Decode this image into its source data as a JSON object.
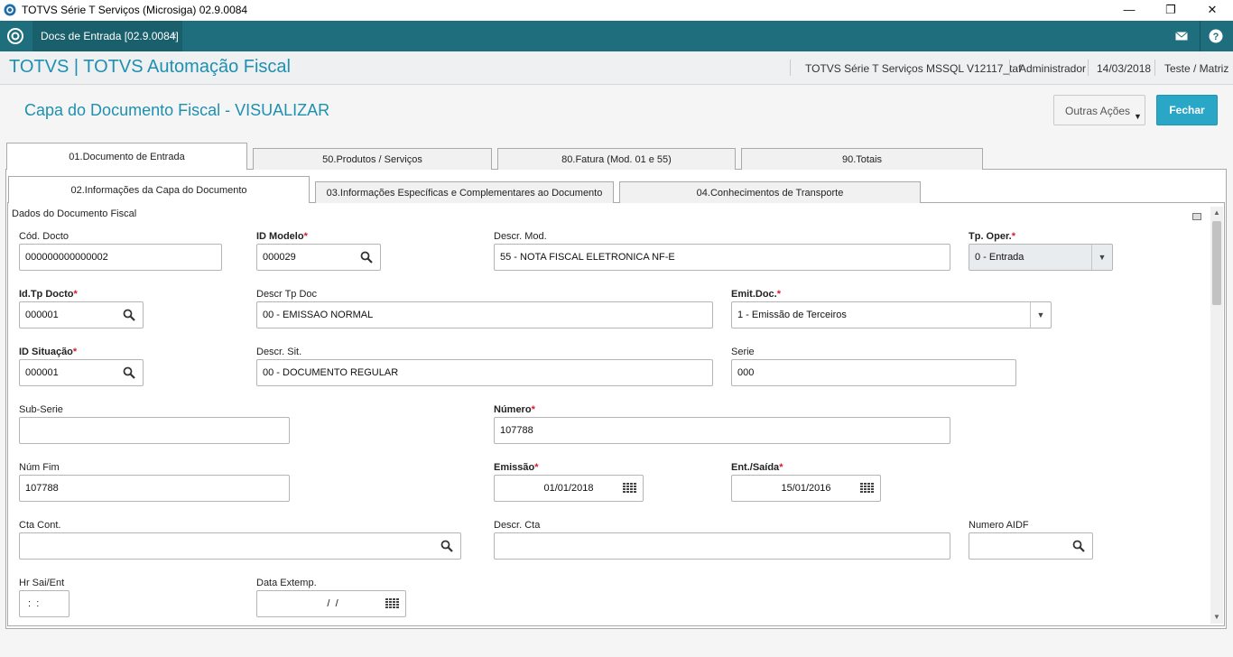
{
  "window": {
    "title": "TOTVS Série T Serviços (Microsiga) 02.9.0084",
    "minimize": "—",
    "restore": "❐",
    "close": "✕"
  },
  "apptab": {
    "label": "Docs de Entrada [02.9.0084]",
    "close": "×"
  },
  "header": {
    "brand": "TOTVS | TOTVS Automação Fiscal",
    "environment": "TOTVS Série T Serviços MSSQL V12117_taf",
    "user": "Administrador",
    "date": "14/03/2018",
    "branch": "Teste / Matriz"
  },
  "page": {
    "title": "Capa do Documento Fiscal - VISUALIZAR",
    "other_actions": "Outras Ações",
    "close": "Fechar"
  },
  "tabs": {
    "outer": [
      "01.Documento de Entrada",
      "50.Produtos / Serviços",
      "80.Fatura (Mod. 01 e 55)",
      "90.Totais"
    ],
    "inner": [
      "02.Informações da Capa do Documento",
      "03.Informações Específicas e Complementares ao Documento",
      "04.Conhecimentos de Transporte"
    ]
  },
  "section": {
    "title": "Dados do Documento Fiscal"
  },
  "fields": {
    "cod_docto": {
      "label": "Cód. Docto",
      "value": "000000000000002"
    },
    "id_modelo": {
      "label": "ID Modelo",
      "value": "000029"
    },
    "descr_mod": {
      "label": "Descr. Mod.",
      "value": "55 - NOTA FISCAL ELETRONICA NF-E"
    },
    "tp_oper": {
      "label": "Tp. Oper.",
      "value": "0 - Entrada"
    },
    "id_tp_docto": {
      "label": "Id.Tp Docto",
      "value": "000001"
    },
    "descr_tp_doc": {
      "label": "Descr Tp Doc",
      "value": "00 - EMISSAO NORMAL"
    },
    "emit_doc": {
      "label": "Emit.Doc.",
      "value": "1 - Emissão de Terceiros"
    },
    "id_situacao": {
      "label": "ID Situação",
      "value": "000001"
    },
    "descr_sit": {
      "label": "Descr. Sit.",
      "value": "00 - DOCUMENTO REGULAR"
    },
    "serie": {
      "label": "Serie",
      "value": "000"
    },
    "sub_serie": {
      "label": "Sub-Serie",
      "value": ""
    },
    "numero": {
      "label": "Número",
      "value": "107788"
    },
    "num_fim": {
      "label": "Núm Fim",
      "value": "107788"
    },
    "emissao": {
      "label": "Emissão",
      "value": "01/01/2018"
    },
    "ent_saida": {
      "label": "Ent./Saída",
      "value": "15/01/2016"
    },
    "cta_cont": {
      "label": "Cta Cont.",
      "value": ""
    },
    "descr_cta": {
      "label": "Descr. Cta",
      "value": ""
    },
    "numero_aidf": {
      "label": "Numero AIDF",
      "value": ""
    },
    "hr_sai_ent": {
      "label": "Hr Sai/Ent",
      "value": " :  :"
    },
    "data_extemp": {
      "label": "Data Extemp.",
      "value": " /  /"
    }
  },
  "required_marker": "*",
  "colors": {
    "teal_bar": "#1f6e7d",
    "brand": "#1e90b0",
    "primary_button": "#2aa6c6",
    "required": "#d0202a"
  }
}
